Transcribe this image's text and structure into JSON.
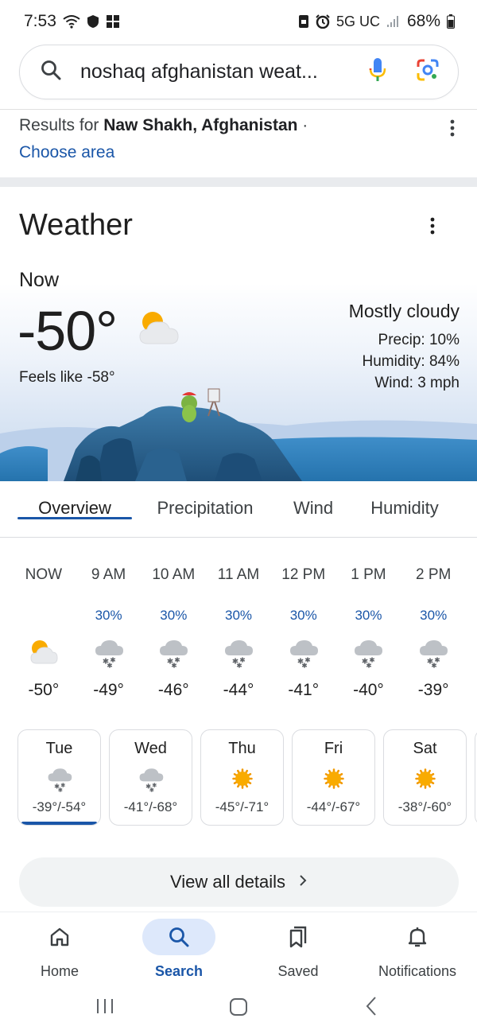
{
  "status_bar": {
    "time": "7:53",
    "network": "5G UC",
    "battery": "68%"
  },
  "search": {
    "query": "noshaq afghanistan weat..."
  },
  "results": {
    "prefix": "Results for ",
    "location": "Naw Shakh, Afghanistan",
    "suffix": " ·",
    "choose_area": "Choose area"
  },
  "weather": {
    "title": "Weather",
    "now_label": "Now",
    "temperature": "-50°",
    "feels_like": "Feels like -58°",
    "condition": "Mostly cloudy",
    "precip": "Precip: 10%",
    "humidity": "Humidity: 84%",
    "wind": "Wind: 3 mph",
    "icon": "partly-cloudy-icon"
  },
  "tabs": [
    {
      "label": "Overview",
      "active": true
    },
    {
      "label": "Precipitation",
      "active": false
    },
    {
      "label": "Wind",
      "active": false
    },
    {
      "label": "Humidity",
      "active": false
    }
  ],
  "hourly": [
    {
      "time": "NOW",
      "precip": "",
      "icon": "partly-cloudy-icon",
      "temp": "-50°"
    },
    {
      "time": "9 AM",
      "precip": "30%",
      "icon": "snow-icon",
      "temp": "-49°"
    },
    {
      "time": "10 AM",
      "precip": "30%",
      "icon": "snow-icon",
      "temp": "-46°"
    },
    {
      "time": "11 AM",
      "precip": "30%",
      "icon": "snow-icon",
      "temp": "-44°"
    },
    {
      "time": "12 PM",
      "precip": "30%",
      "icon": "snow-icon",
      "temp": "-41°"
    },
    {
      "time": "1 PM",
      "precip": "30%",
      "icon": "snow-icon",
      "temp": "-40°"
    },
    {
      "time": "2 PM",
      "precip": "30%",
      "icon": "snow-icon",
      "temp": "-39°"
    }
  ],
  "daily": [
    {
      "day": "Tue",
      "icon": "snow-icon",
      "range": "-39°/-54°",
      "active": true
    },
    {
      "day": "Wed",
      "icon": "snow-icon",
      "range": "-41°/-68°",
      "active": false
    },
    {
      "day": "Thu",
      "icon": "sun-icon",
      "range": "-45°/-71°",
      "active": false
    },
    {
      "day": "Fri",
      "icon": "sun-icon",
      "range": "-44°/-67°",
      "active": false
    },
    {
      "day": "Sat",
      "icon": "sun-icon",
      "range": "-38°/-60°",
      "active": false
    }
  ],
  "view_all": {
    "label": "View all details"
  },
  "bottom_nav": [
    {
      "label": "Home",
      "icon": "home-icon",
      "active": false
    },
    {
      "label": "Search",
      "icon": "search-icon",
      "active": true
    },
    {
      "label": "Saved",
      "icon": "bookmarks-icon",
      "active": false
    },
    {
      "label": "Notifications",
      "icon": "bell-icon",
      "active": false
    }
  ],
  "colors": {
    "accent": "#1a56a8",
    "sun": "#f9a825",
    "cloud": "#e8eaed"
  }
}
